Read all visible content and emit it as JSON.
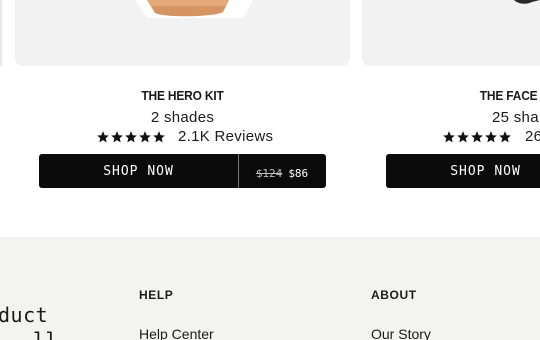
{
  "products": [
    {
      "title": "THE HERO KIT",
      "shades": "2 shades",
      "rating_value": 5,
      "reviews": "2.1K Reviews",
      "shop_label": "SHOP NOW",
      "price_old": "$124",
      "price_new": "$86"
    },
    {
      "title": "THE FACE I",
      "shades": "25 sha",
      "rating_value": 5,
      "reviews": "26",
      "shop_label": "SHOP NOW"
    }
  ],
  "footer": {
    "tagline_line1": "duct",
    "tagline_line2": "ll",
    "help": {
      "heading": "HELP",
      "link": "Help Center"
    },
    "about": {
      "heading": "ABOUT",
      "link": "Our Story"
    }
  },
  "colors": {
    "button_bg": "#0b0b0b",
    "footer_bg": "#f3f3f2",
    "card_bg": "#f2f2f2"
  }
}
